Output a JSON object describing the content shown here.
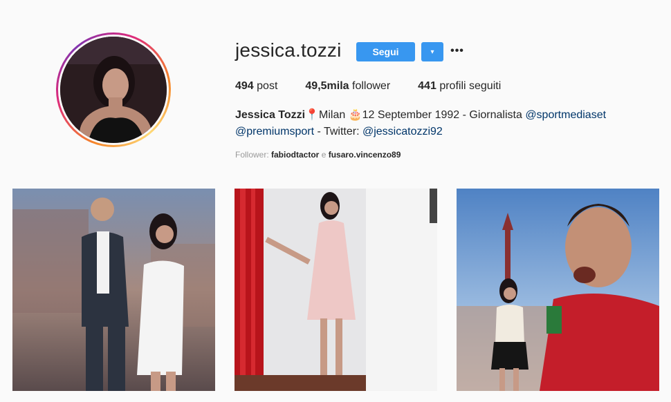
{
  "profile": {
    "username": "jessica.tozzi",
    "follow_label": "Segui",
    "dropdown_icon": "▾",
    "more_icon": "•••"
  },
  "stats": {
    "posts_count": "494",
    "posts_label": "post",
    "followers_count": "49,5mila",
    "followers_label": "follower",
    "following_count": "441",
    "following_label": "profili seguiti"
  },
  "bio": {
    "full_name": "Jessica Tozzi",
    "text_1": "📍Milan 🎂12 September 1992 - Giornalista ",
    "mention_1": "@sportmediaset",
    "mention_2": "@premiumsport",
    "text_2": " - Twitter: ",
    "mention_3": "@jessicatozzi92"
  },
  "followed_by": {
    "prefix": "Follower: ",
    "user_1": "fabiodtactor",
    "separator": " e ",
    "user_2": "fusaro.vincenzo89"
  },
  "posts": [
    {
      "alt": "post-1"
    },
    {
      "alt": "post-2"
    },
    {
      "alt": "post-3"
    }
  ],
  "colors": {
    "accent": "#3897f0",
    "link": "#003569",
    "background": "#fafafa"
  }
}
